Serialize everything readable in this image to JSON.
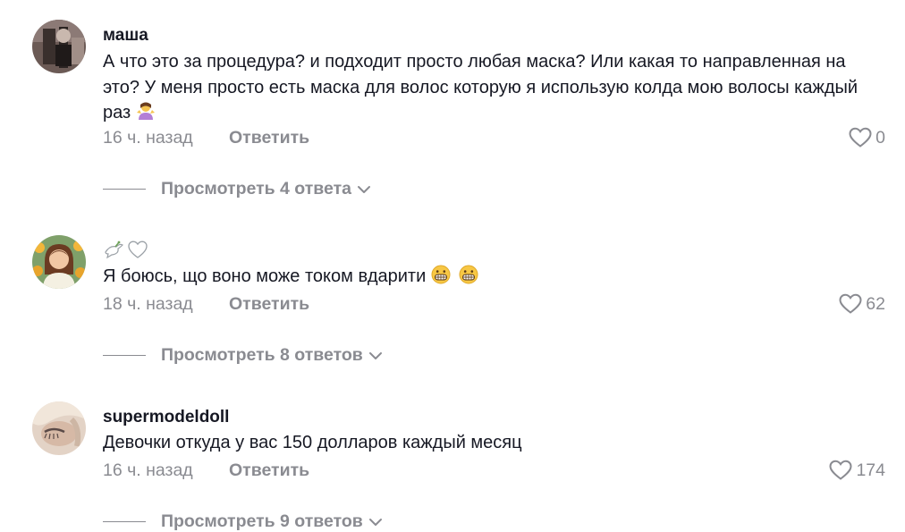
{
  "comments": [
    {
      "username": "маша",
      "text": "А что это за процедура? и подходит просто любая маска? Или какая то направленная на это? У меня просто есть маска для волос которую я использую колда мою волосы каждый раз",
      "emoji": "shrug-emoji",
      "time": "16 ч. назад",
      "reply": "Ответить",
      "likes": "0",
      "view_replies": "Просмотреть 4 ответа"
    },
    {
      "username_icons": [
        "dove-icon",
        "white-heart-icon"
      ],
      "text": "Я боюсь, що воно може током вдарити",
      "emoji": "grimacing-face-emoji",
      "time": "18 ч. назад",
      "reply": "Ответить",
      "likes": "62",
      "view_replies": "Просмотреть 8 ответов"
    },
    {
      "username": "supermodeldoll",
      "text": "Девочки откуда у вас 150 долларов каждый месяц",
      "time": "16 ч. назад",
      "reply": "Ответить",
      "likes": "174",
      "view_replies": "Просмотреть 9 ответов"
    }
  ],
  "colors": {
    "text_primary": "#161823",
    "text_secondary": "#8a8b91",
    "background": "#ffffff"
  }
}
